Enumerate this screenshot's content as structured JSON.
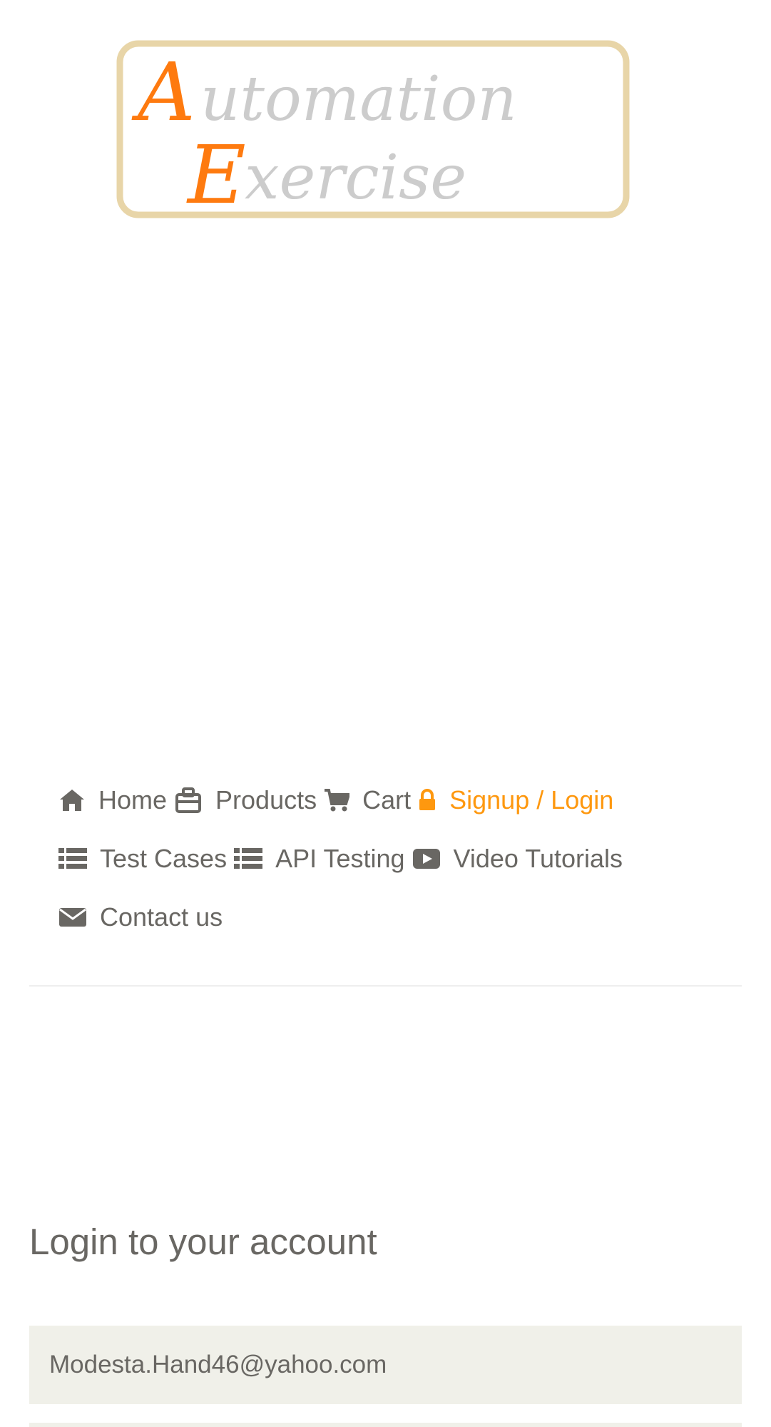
{
  "brand": {
    "logo_line1": "Automation",
    "logo_line2": "Exercise",
    "accent_color": "#FE980F",
    "logo_border_color": "#E8D5A8",
    "logo_text_color": "#CCCCCC"
  },
  "nav": {
    "row1": [
      {
        "label": "Home",
        "icon": "home-icon"
      },
      {
        "label": "Products",
        "icon": "products-icon"
      },
      {
        "label": "Cart",
        "icon": "cart-icon"
      },
      {
        "label": "Signup / Login",
        "icon": "lock-icon",
        "active": true
      }
    ],
    "row2": [
      {
        "label": "Test Cases",
        "icon": "list-icon"
      },
      {
        "label": "API Testing",
        "icon": "list-icon"
      },
      {
        "label": "Video Tutorials",
        "icon": "youtube-play-icon"
      }
    ],
    "row3": [
      {
        "label": "Contact us",
        "icon": "envelope-icon"
      }
    ]
  },
  "login": {
    "title": "Login to your account",
    "email_value": "Modesta.Hand46@yahoo.com"
  }
}
